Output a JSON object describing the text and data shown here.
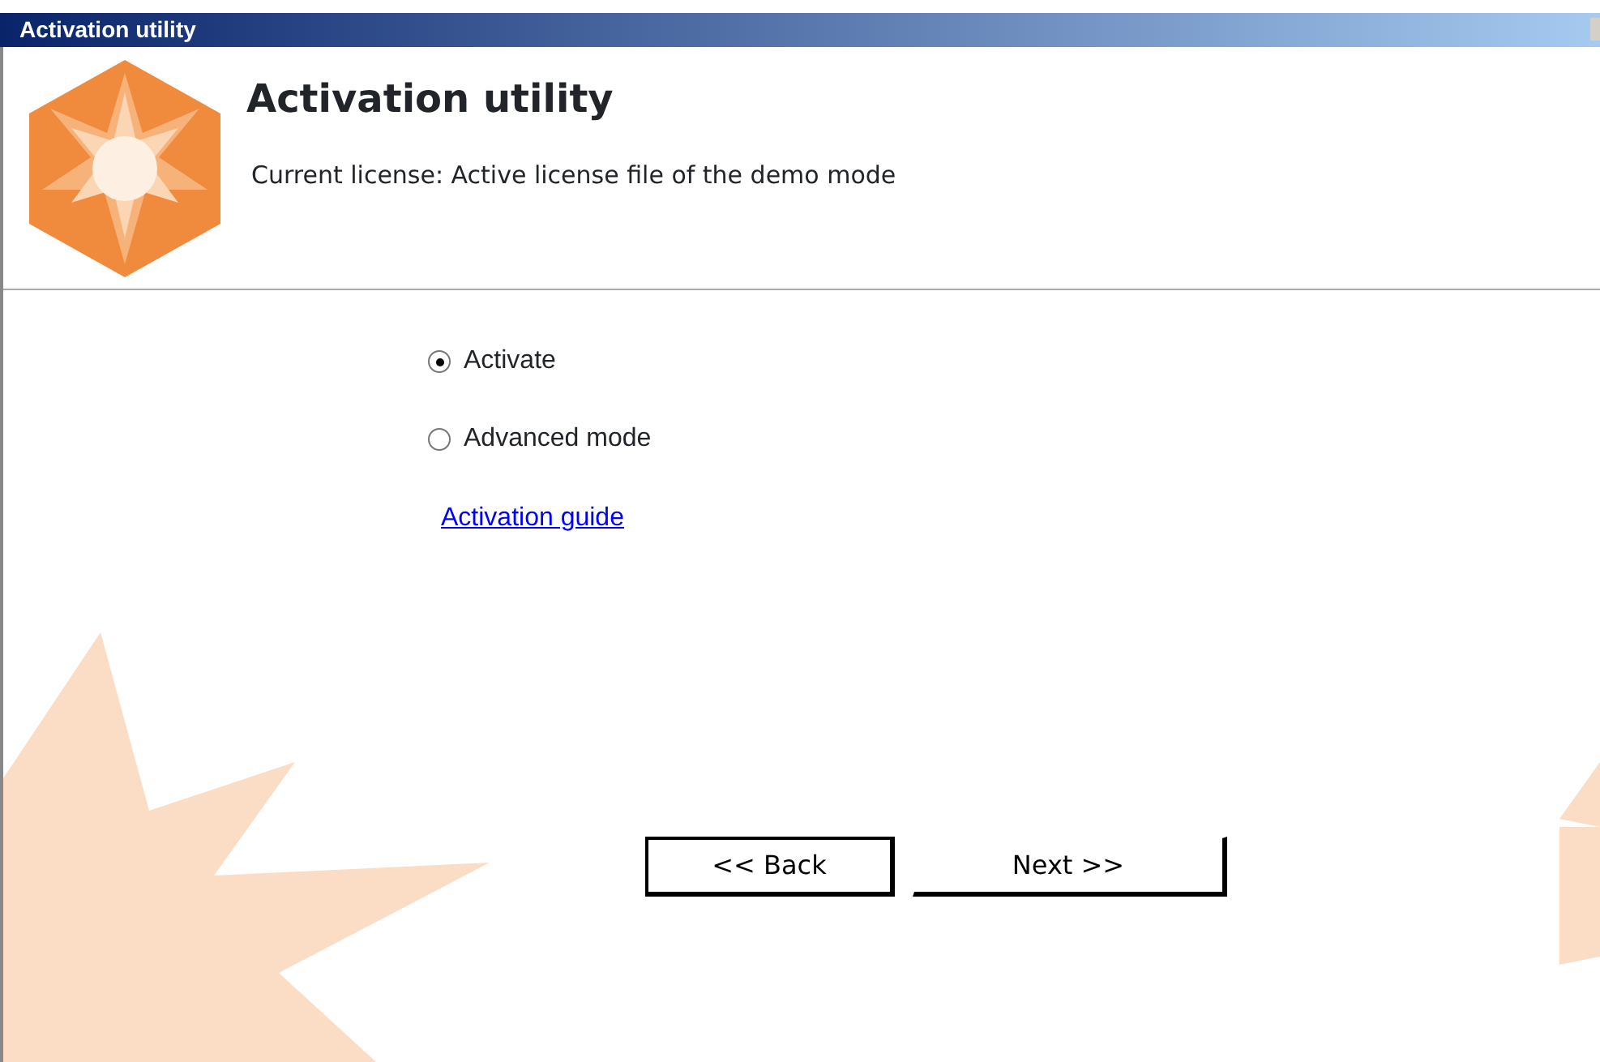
{
  "window": {
    "title": "Activation utility"
  },
  "header": {
    "title": "Activation utility",
    "license": "Current license: Active license file of the demo mode"
  },
  "options": [
    {
      "label": "Activate",
      "selected": true
    },
    {
      "label": "Advanced mode",
      "selected": false
    }
  ],
  "link": "Activation guide",
  "buttons": [
    {
      "label": "<< Back",
      "kind": "back"
    },
    {
      "label": "Next >>",
      "kind": "next"
    }
  ]
}
